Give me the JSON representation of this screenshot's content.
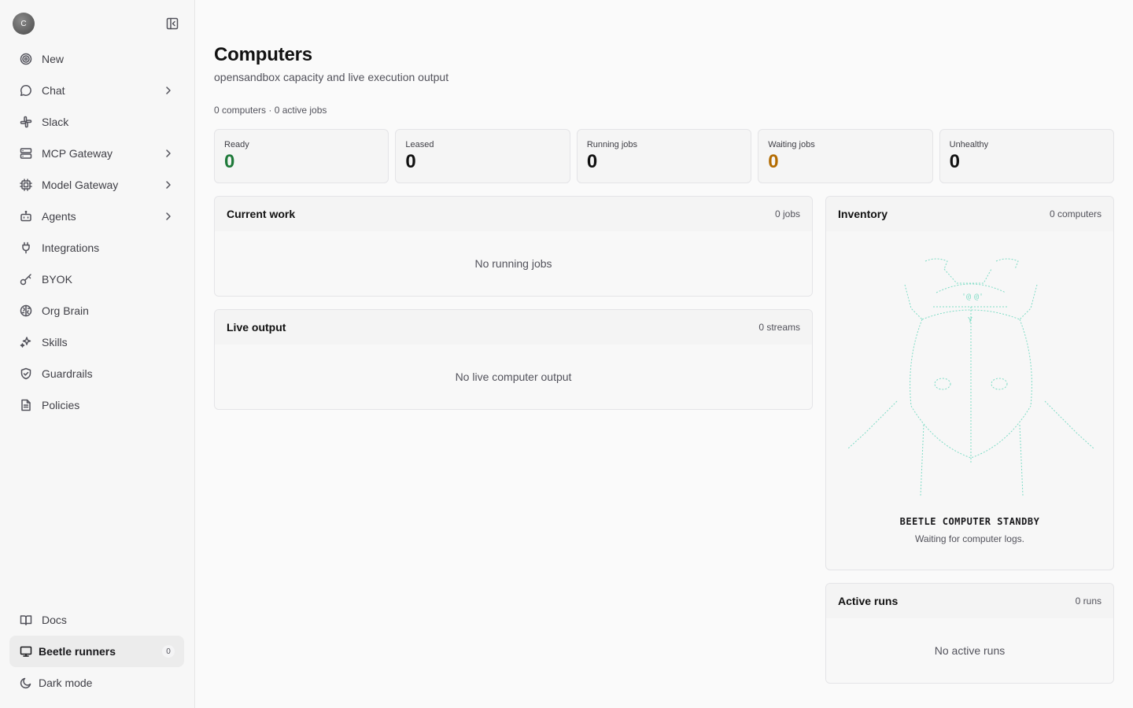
{
  "sidebar": {
    "avatar_initial": "C",
    "nav": [
      {
        "label": "New",
        "icon": "target-icon"
      },
      {
        "label": "Chat",
        "icon": "chat-bubble-icon"
      },
      {
        "label": "Slack",
        "icon": "slack-icon"
      },
      {
        "label": "MCP Gateway",
        "icon": "server-icon"
      },
      {
        "label": "Model Gateway",
        "icon": "cpu-chip-icon"
      },
      {
        "label": "Agents",
        "icon": "bot-icon"
      },
      {
        "label": "Integrations",
        "icon": "plug-icon"
      },
      {
        "label": "BYOK",
        "icon": "key-icon"
      },
      {
        "label": "Org Brain",
        "icon": "brain-icon"
      },
      {
        "label": "Skills",
        "icon": "sparkles-icon"
      },
      {
        "label": "Guardrails",
        "icon": "shield-check-icon"
      },
      {
        "label": "Policies",
        "icon": "document-icon"
      }
    ],
    "bottom": {
      "docs": "Docs",
      "runners": "Beetle runners",
      "runners_count": "0",
      "dark_mode": "Dark mode"
    }
  },
  "page": {
    "title": "Computers",
    "subtitle": "opensandbox capacity and live execution output",
    "summary": "0 computers · 0 active jobs"
  },
  "stats": [
    {
      "label": "Ready",
      "value": "0",
      "color": "#1f7a3a"
    },
    {
      "label": "Leased",
      "value": "0",
      "color": "#111111"
    },
    {
      "label": "Running jobs",
      "value": "0",
      "color": "#111111"
    },
    {
      "label": "Waiting jobs",
      "value": "0",
      "color": "#b36b00"
    },
    {
      "label": "Unhealthy",
      "value": "0",
      "color": "#111111"
    }
  ],
  "current_work": {
    "title": "Current work",
    "count": "0 jobs",
    "empty": "No running jobs"
  },
  "live_output": {
    "title": "Live output",
    "count": "0 streams",
    "empty": "No live computer output"
  },
  "inventory": {
    "title": "Inventory",
    "count": "0 computers",
    "standby_title": "BEETLE COMPUTER STANDBY",
    "standby_sub": "Waiting for computer logs.",
    "ascii_color": "#7fdcc6"
  },
  "active_runs": {
    "title": "Active runs",
    "count": "0 runs",
    "empty": "No active runs"
  }
}
